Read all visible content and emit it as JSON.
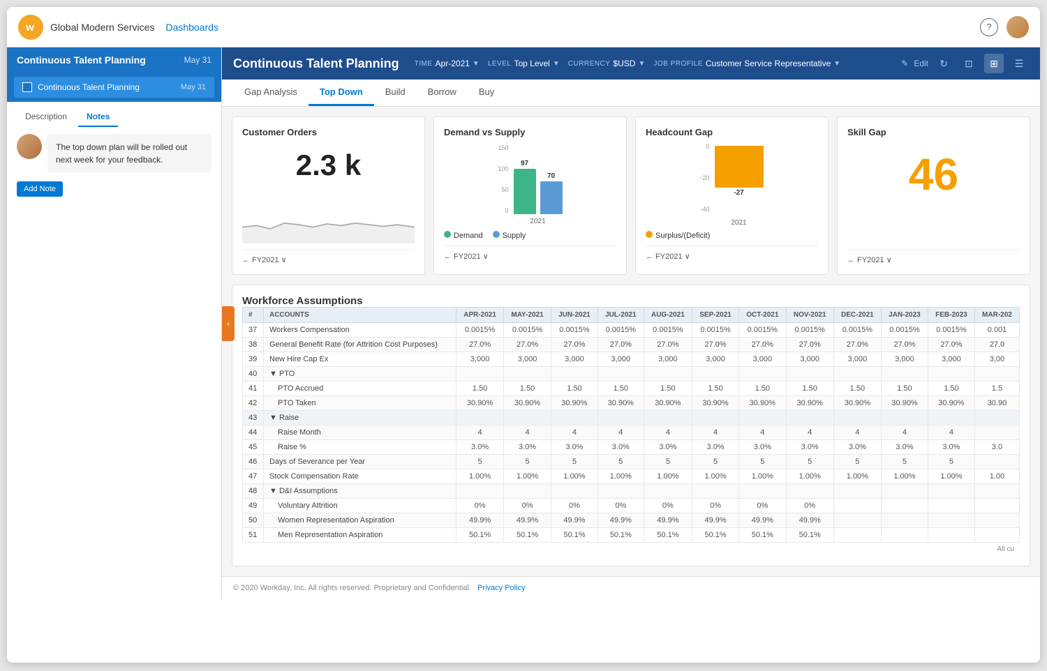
{
  "app": {
    "company": "Global Modern Services",
    "nav_link": "Dashboards",
    "logo_letter": "w"
  },
  "sidebar": {
    "title": "Continuous Talent Planning",
    "date": "May 31",
    "item_label": "Continuous Talent Planning",
    "item_date": "May 31",
    "tabs": [
      "Description",
      "Notes"
    ],
    "active_tab": "Notes",
    "note_text": "The top down plan will be rolled out next week for your feedback.",
    "add_note_label": "Add Note"
  },
  "dashboard": {
    "title": "Continuous Talent Planning",
    "filters": {
      "time_label": "TIME",
      "time_value": "Apr-2021",
      "level_label": "LEVEL",
      "level_value": "Top Level",
      "currency_label": "CURRENCY",
      "currency_value": "$USD",
      "job_profile_label": "JOB PROFILE",
      "job_profile_value": "Customer Service Representative"
    },
    "edit_label": "Edit",
    "tabs": [
      "Gap Analysis",
      "Top Down",
      "Build",
      "Borrow",
      "Buy"
    ],
    "active_tab": "Top Down"
  },
  "kpis": {
    "customer_orders": {
      "title": "Customer Orders",
      "value": "2.3 k",
      "footer": "← FY2021 ∨",
      "sparkline": [
        40,
        42,
        38,
        45,
        43,
        40,
        44,
        42,
        45,
        43,
        41,
        44,
        42
      ]
    },
    "demand_supply": {
      "title": "Demand vs Supply",
      "demand_value": 97,
      "supply_value": 70,
      "year_label": "2021",
      "legend_demand": "Demand",
      "legend_supply": "Supply",
      "footer": "← FY2021 ∨",
      "y_labels": [
        "150",
        "100",
        "50",
        "0"
      ]
    },
    "headcount_gap": {
      "title": "Headcount Gap",
      "bar_value": -27,
      "year_label": "2021",
      "legend_label": "Surplus/(Deficit)",
      "footer": "← FY2021 ∨",
      "y_labels": [
        "0",
        "-20",
        "-40"
      ]
    },
    "skill_gap": {
      "title": "Skill Gap",
      "value": "46",
      "footer": "← FY2021 ∨"
    }
  },
  "workforce": {
    "section_title": "Workforce Assumptions",
    "columns": [
      "#",
      "ACCOUNTS",
      "APR-2021",
      "MAY-2021",
      "JUN-2021",
      "JUL-2021",
      "AUG-2021",
      "SEP-2021",
      "OCT-2021",
      "NOV-2021",
      "DEC-2021",
      "JAN-2023",
      "FEB-2023",
      "MAR-202"
    ],
    "rows": [
      {
        "num": "37",
        "account": "Workers Compensation",
        "vals": [
          "0.0015%",
          "0.0015%",
          "0.0015%",
          "0.0015%",
          "0.0015%",
          "0.0015%",
          "0.0015%",
          "0.0015%",
          "0.0015%",
          "0.0015%",
          "0.0015%",
          "0.001"
        ],
        "indent": false
      },
      {
        "num": "38",
        "account": "General Benefit Rate (for Attrition Cost Purposes)",
        "vals": [
          "27.0%",
          "27.0%",
          "27.0%",
          "27.0%",
          "27.0%",
          "27.0%",
          "27.0%",
          "27.0%",
          "27.0%",
          "27.0%",
          "27.0%",
          "27.0"
        ],
        "indent": false
      },
      {
        "num": "39",
        "account": "New Hire Cap Ex",
        "vals": [
          "3,000",
          "3,000",
          "3,000",
          "3,000",
          "3,000",
          "3,000",
          "3,000",
          "3,000",
          "3,000",
          "3,000",
          "3,000",
          "3,00"
        ],
        "indent": false
      },
      {
        "num": "40",
        "account": "▼  PTO",
        "vals": [
          "",
          "",
          "",
          "",
          "",
          "",
          "",
          "",
          "",
          "",
          "",
          ""
        ],
        "indent": false,
        "group": true
      },
      {
        "num": "41",
        "account": "PTO Accrued",
        "vals": [
          "1.50",
          "1.50",
          "1.50",
          "1.50",
          "1.50",
          "1.50",
          "1.50",
          "1.50",
          "1.50",
          "1.50",
          "1.50",
          "1.5"
        ],
        "indent": true
      },
      {
        "num": "42",
        "account": "PTO Taken",
        "vals": [
          "30.90%",
          "30.90%",
          "30.90%",
          "30.90%",
          "30.90%",
          "30.90%",
          "30.90%",
          "30.90%",
          "30.90%",
          "30.90%",
          "30.90%",
          "30.90"
        ],
        "indent": true
      },
      {
        "num": "43",
        "account": "▼  Raise",
        "vals": [
          "",
          "",
          "",
          "",
          "",
          "",
          "",
          "",
          "",
          "",
          "",
          ""
        ],
        "indent": false,
        "group": true
      },
      {
        "num": "44",
        "account": "Raise Month",
        "vals": [
          "4",
          "4",
          "4",
          "4",
          "4",
          "4",
          "4",
          "4",
          "4",
          "4",
          "4",
          ""
        ],
        "indent": true
      },
      {
        "num": "45",
        "account": "Raise %",
        "vals": [
          "3.0%",
          "3.0%",
          "3.0%",
          "3.0%",
          "3.0%",
          "3.0%",
          "3.0%",
          "3.0%",
          "3.0%",
          "3.0%",
          "3.0%",
          "3.0"
        ],
        "indent": true
      },
      {
        "num": "46",
        "account": "Days of Severance per Year",
        "vals": [
          "5",
          "5",
          "5",
          "5",
          "5",
          "5",
          "5",
          "5",
          "5",
          "5",
          "5",
          ""
        ],
        "indent": false
      },
      {
        "num": "47",
        "account": "Stock Compensation Rate",
        "vals": [
          "1.00%",
          "1.00%",
          "1.00%",
          "1.00%",
          "1.00%",
          "1.00%",
          "1.00%",
          "1.00%",
          "1.00%",
          "1.00%",
          "1.00%",
          "1.00"
        ],
        "indent": false
      },
      {
        "num": "48",
        "account": "▼  D&I Assumptions",
        "vals": [
          "",
          "",
          "",
          "",
          "",
          "",
          "",
          "",
          "",
          "",
          "",
          ""
        ],
        "indent": false,
        "group": true
      },
      {
        "num": "49",
        "account": "Voluntary Attrition",
        "vals": [
          "0%",
          "0%",
          "0%",
          "0%",
          "0%",
          "0%",
          "0%",
          "0%",
          "",
          "",
          "",
          ""
        ],
        "indent": true
      },
      {
        "num": "50",
        "account": "Women Representation Aspiration",
        "vals": [
          "49.9%",
          "49.9%",
          "49.9%",
          "49.9%",
          "49.9%",
          "49.9%",
          "49.9%",
          "49.9%",
          "",
          "",
          "",
          ""
        ],
        "indent": true
      },
      {
        "num": "51",
        "account": "Men Representation Aspiration",
        "vals": [
          "50.1%",
          "50.1%",
          "50.1%",
          "50.1%",
          "50.1%",
          "50.1%",
          "50.1%",
          "50.1%",
          "",
          "",
          "",
          ""
        ],
        "indent": true
      }
    ],
    "all_curr_label": "All cu"
  },
  "footer": {
    "copyright": "© 2020 Workday, Inc. All rights reserved. Proprietary and Confidential.",
    "privacy_link": "Privacy Policy"
  }
}
